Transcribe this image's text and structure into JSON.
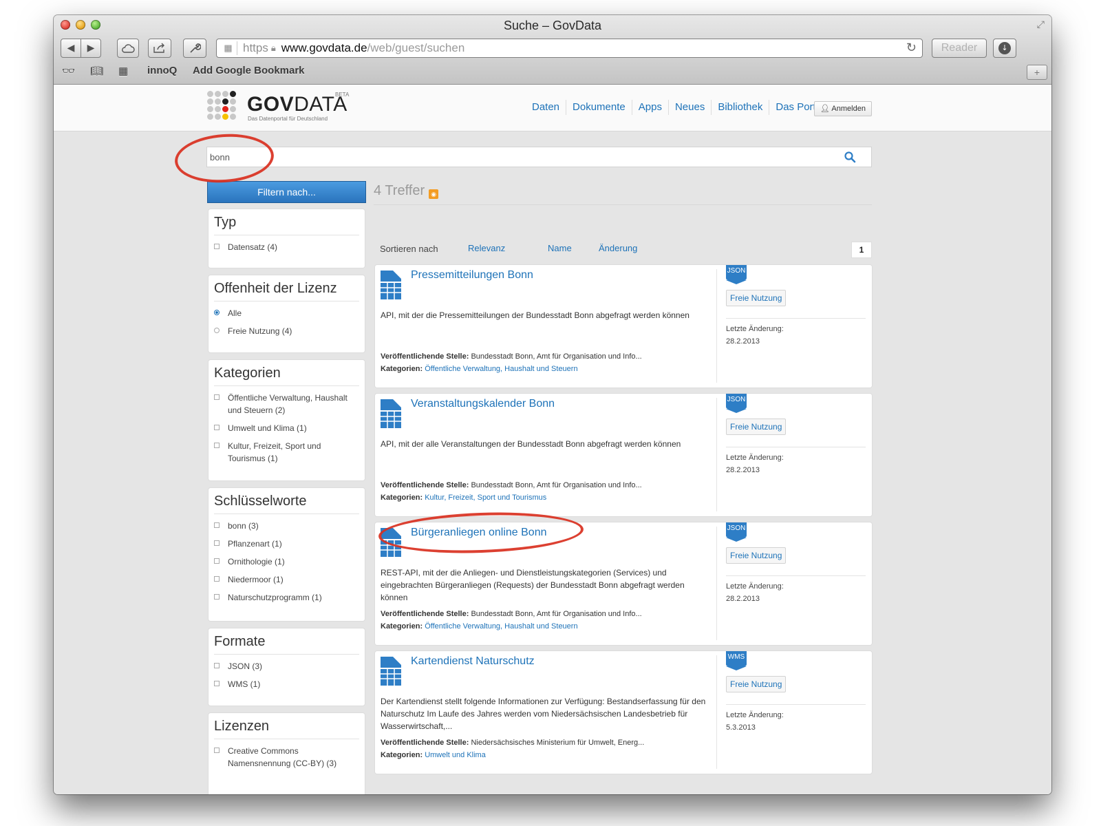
{
  "browser": {
    "window_title": "Suche – GovData",
    "url": {
      "scheme": "https",
      "domain": "www.govdata.de",
      "path": "/web/guest/suchen"
    },
    "reader_label": "Reader",
    "bookmarks": [
      "innoQ",
      "Add Google Bookmark"
    ]
  },
  "site": {
    "logo": {
      "name_bold": "GOV",
      "name_rest": "DATA",
      "tagline": "Das Datenportal für Deutschland",
      "badge": "BETA"
    },
    "nav": [
      "Daten",
      "Dokumente",
      "Apps",
      "Neues",
      "Bibliothek",
      "Das Portal"
    ],
    "login_label": "Anmelden"
  },
  "search": {
    "value": "bonn"
  },
  "filter_button": "Filtern nach...",
  "facets": {
    "typ": {
      "title": "Typ",
      "items": [
        "Datensatz (4)"
      ]
    },
    "lizenz": {
      "title": "Offenheit der Lizenz",
      "items": [
        "Alle",
        "Freie Nutzung (4)"
      ]
    },
    "kategorien": {
      "title": "Kategorien",
      "items": [
        "Öffentliche Verwaltung, Haushalt und Steuern (2)",
        "Umwelt und Klima (1)",
        "Kultur, Freizeit, Sport und Tourismus (1)"
      ]
    },
    "schluesselworte": {
      "title": "Schlüsselworte",
      "items": [
        "bonn (3)",
        "Pflanzenart (1)",
        "Ornithologie (1)",
        "Niedermoor (1)",
        "Naturschutzprogramm (1)"
      ]
    },
    "formate": {
      "title": "Formate",
      "items": [
        "JSON (3)",
        "WMS (1)"
      ]
    },
    "lizenzen": {
      "title": "Lizenzen",
      "items": [
        "Creative Commons Namensnennung (CC-BY) (3)"
      ]
    }
  },
  "results_header": {
    "count": "4 Treffer"
  },
  "sort": {
    "label": "Sortieren nach",
    "options": [
      "Relevanz",
      "Name",
      "Änderung"
    ],
    "page": "1"
  },
  "results": [
    {
      "title": "Pressemitteilungen Bonn",
      "description": "API, mit der die Pressemitteilungen der Bundesstadt Bonn abgefragt werden können",
      "publisher_label": "Veröffentlichende Stelle:",
      "publisher": "Bundesstadt Bonn, Amt für Organisation und Info...",
      "categories_label": "Kategorien:",
      "categories": "Öffentliche Verwaltung, Haushalt und Steuern",
      "format": "JSON",
      "license": "Freie Nutzung",
      "changed_label": "Letzte Änderung:",
      "changed": "28.2.2013"
    },
    {
      "title": "Veranstaltungskalender Bonn",
      "description": "API, mit der alle Veranstaltungen der Bundesstadt Bonn abgefragt werden können",
      "publisher_label": "Veröffentlichende Stelle:",
      "publisher": "Bundesstadt Bonn, Amt für Organisation und Info...",
      "categories_label": "Kategorien:",
      "categories": "Kultur, Freizeit, Sport und Tourismus",
      "format": "JSON",
      "license": "Freie Nutzung",
      "changed_label": "Letzte Änderung:",
      "changed": "28.2.2013"
    },
    {
      "title": "Bürgeranliegen online Bonn",
      "description": "REST-API, mit der die Anliegen- und Dienstleistungskategorien (Services) und eingebrachten Bürgeranliegen (Requests) der Bundesstadt Bonn abgefragt werden können",
      "publisher_label": "Veröffentlichende Stelle:",
      "publisher": "Bundesstadt Bonn, Amt für Organisation und Info...",
      "categories_label": "Kategorien:",
      "categories": "Öffentliche Verwaltung, Haushalt und Steuern",
      "format": "JSON",
      "license": "Freie Nutzung",
      "changed_label": "Letzte Änderung:",
      "changed": "28.2.2013"
    },
    {
      "title": "Kartendienst Naturschutz",
      "description": "Der Kartendienst stellt folgende Informationen zur Verfügung: Bestandserfassung für den Naturschutz Im Laufe des Jahres werden vom Niedersächsischen Landesbetrieb für Wasserwirtschaft,...",
      "publisher_label": "Veröffentlichende Stelle:",
      "publisher": "Niedersächsisches Ministerium für Umwelt, Energ...",
      "categories_label": "Kategorien:",
      "categories": "Umwelt und Klima",
      "format": "WMS",
      "license": "Freie Nutzung",
      "changed_label": "Letzte Änderung:",
      "changed": "5.3.2013"
    }
  ],
  "colors": {
    "link": "#1d72b8",
    "accent_button": "#2a74bd",
    "annotation": "#d9301f",
    "rss": "#f39c23"
  },
  "icons": [
    "back-arrow-icon",
    "forward-arrow-icon",
    "icloud-icon",
    "share-icon",
    "tools-icon",
    "lock-icon",
    "reload-icon",
    "download-icon",
    "reading-list-icon",
    "bookmarks-icon",
    "top-sites-icon",
    "search-icon",
    "rss-icon",
    "dataset-icon",
    "user-icon"
  ]
}
